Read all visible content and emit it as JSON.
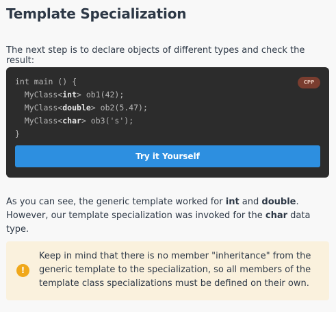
{
  "lesson": {
    "title": "Template Specialization",
    "intro": "The next step is to declare objects of different types and check the result:"
  },
  "code_block": {
    "language_badge": "CPP",
    "lines": [
      [
        {
          "t": "int main () {"
        }
      ],
      [
        {
          "t": "  MyClass<"
        },
        {
          "t": "int",
          "b": true
        },
        {
          "t": "> ob1(42);"
        }
      ],
      [
        {
          "t": "  MyClass<"
        },
        {
          "t": "double",
          "b": true
        },
        {
          "t": "> ob2(5.47);"
        }
      ],
      [
        {
          "t": "  MyClass<"
        },
        {
          "t": "char",
          "b": true
        },
        {
          "t": "> ob3('s');"
        }
      ],
      [
        {
          "t": "}"
        }
      ]
    ],
    "try_button_label": "Try it Yourself"
  },
  "paragraph": {
    "segments": [
      {
        "t": "As you can see, the generic template worked for "
      },
      {
        "t": "int",
        "b": true
      },
      {
        "t": " and "
      },
      {
        "t": "double",
        "b": true
      },
      {
        "t": ". However, our template specialization was invoked for the "
      },
      {
        "t": "char",
        "b": true
      },
      {
        "t": " data type."
      }
    ]
  },
  "note": {
    "icon": "exclamation-icon",
    "icon_glyph": "!",
    "text": "Keep in mind that there is no member \"inheritance\" from the generic template to the specialization, so all members of the template class specializations must be defined on their own."
  },
  "colors": {
    "code_background": "#2c2c2c",
    "button": "#2d8fe0",
    "badge": "#7a3d2f",
    "note_background": "#faf1dd",
    "note_icon": "#f0a81a"
  }
}
